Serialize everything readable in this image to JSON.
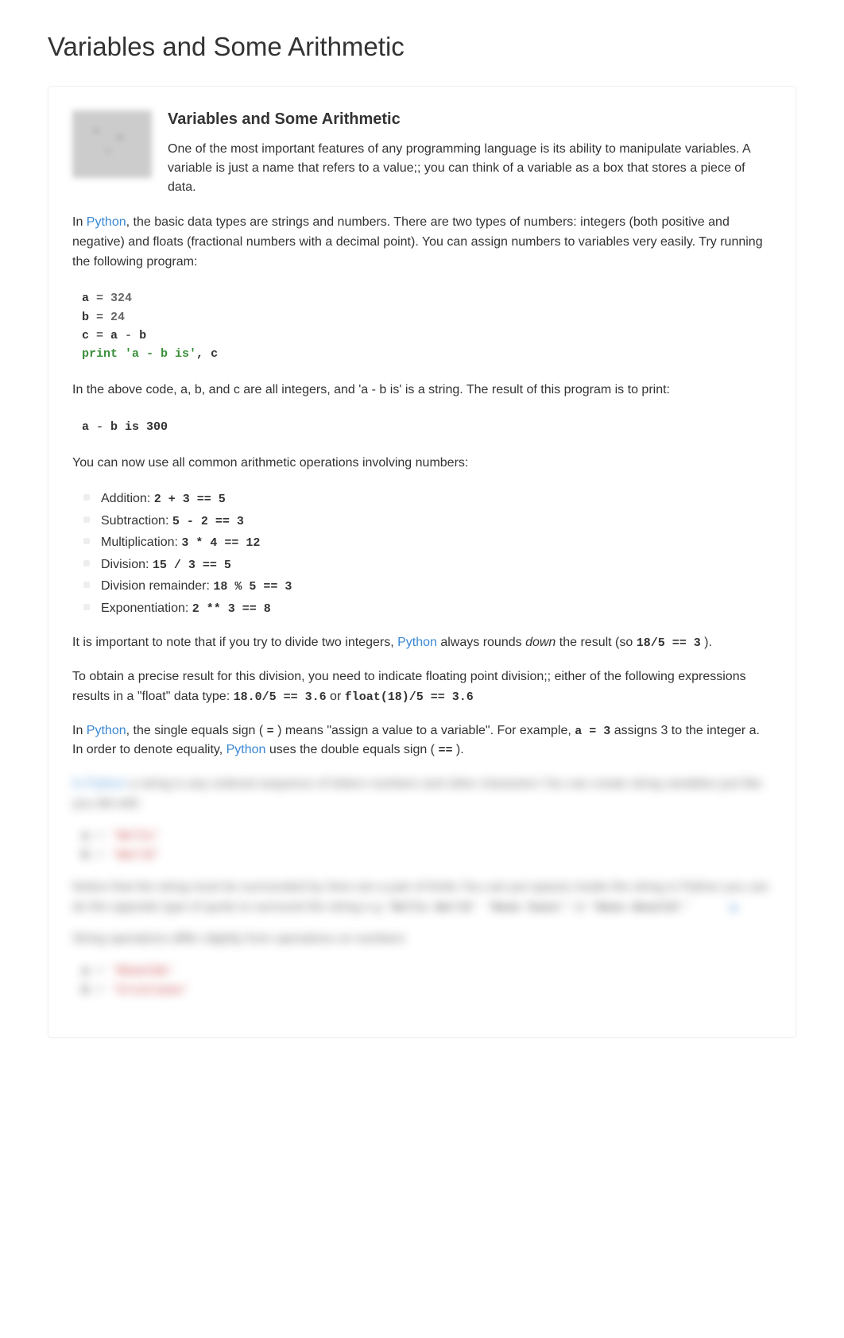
{
  "page_title": "Variables and Some Arithmetic",
  "section": {
    "heading": "Variables and Some Arithmetic",
    "intro": "One of the most important features of any programming language is its ability to manipulate variables. A variable is just a name that refers to a value;; you can think of a variable as a box that stores a piece of data."
  },
  "para1_parts": {
    "p1": "In ",
    "link": "Python",
    "p2": ", the basic data types are strings and numbers. There are two types of numbers: integers (both positive and negative) and floats (fractional numbers with a decimal point). You can assign numbers to variables very easily. Try running the following program:"
  },
  "code1": {
    "line1_a": "a",
    "line1_eq": " = ",
    "line1_val": "324",
    "line2_a": "b",
    "line2_eq": " = ",
    "line2_val": "24",
    "line3_a": "c",
    "line3_eq": " = ",
    "line3_b": "a",
    "line3_op": " - ",
    "line3_c": "b",
    "line4_kw": "print",
    "line4_str": " 'a - b is'",
    "line4_comma": ", ",
    "line4_c": "c"
  },
  "para2": "In the above code, a, b, and c are all integers, and 'a - b is' is a string. The result of this program is to print:",
  "code2": {
    "a": "a",
    "op": " - ",
    "rest": "b is 300"
  },
  "para3": "You can now use all common arithmetic operations involving numbers:",
  "ops": [
    {
      "label": "Addition: ",
      "code": "2 + 3 == 5"
    },
    {
      "label": "Subtraction: ",
      "code": "5 - 2 == 3"
    },
    {
      "label": "Multiplication: ",
      "code": "3 * 4 == 12"
    },
    {
      "label": "Division: ",
      "code": "15 / 3 == 5"
    },
    {
      "label": "Division remainder: ",
      "code": "18 % 5 == 3"
    },
    {
      "label": "Exponentiation: ",
      "code": "2 ** 3 == 8"
    }
  ],
  "para4": {
    "p1": "It is important to note that if you try to divide two integers, ",
    "link": "Python",
    "p2": " always rounds ",
    "em": "down",
    "p3": " the result (so ",
    "code": "18/5 == 3",
    "p4": " )."
  },
  "para5": {
    "p1": "To obtain a precise result for this division, you need to indicate floating point division;; either of the following expressions results in a \"float\" data type: ",
    "code1": "18.0/5 == 3.6",
    "or": " or ",
    "code2": "float(18)/5 == 3.6"
  },
  "para6": {
    "p1": "In ",
    "link1": "Python",
    "p2": ", the single equals sign ( ",
    "code1": "=",
    "p3": " ) means \"assign a value to a variable\". For example, ",
    "code2": "a = 3",
    "p4": " assigns 3 to the integer a. In order to denote equality, ",
    "link2": "Python",
    "p5": " uses the double equals sign ( ",
    "code3": "==",
    "p6": " )."
  },
  "blurred": {
    "p1_link": "In Python",
    "p1_rest": "  a string is any ordered sequence of letters numbers and other characters  You can create string variables just like you did with",
    "c1_a": "a",
    "c1_eq": " = ",
    "c1_v": "'Hello'",
    "c2_a": "b",
    "c2_eq": " = ",
    "c2_v": "'World'",
    "p2": "Notice that the string must be surrounded by        Here are a pair of limits  You can put spaces inside the string  in Python you can do the opposite type of quote to surround the string  e g",
    "p2_code1": "'Hello World'  'Hooo  hooo!'",
    "p2_or": "       or      ",
    "p2_code2": "'Hooo  Wooold!'",
    "p3": "String operations differ slightly from operations on numbers",
    "c3_a": "a",
    "c3_eq": " = ",
    "c3_v": "'Ronaldo'",
    "c4_a": "b",
    "c4_eq": " = ",
    "c4_v": "'Cristiano'"
  }
}
